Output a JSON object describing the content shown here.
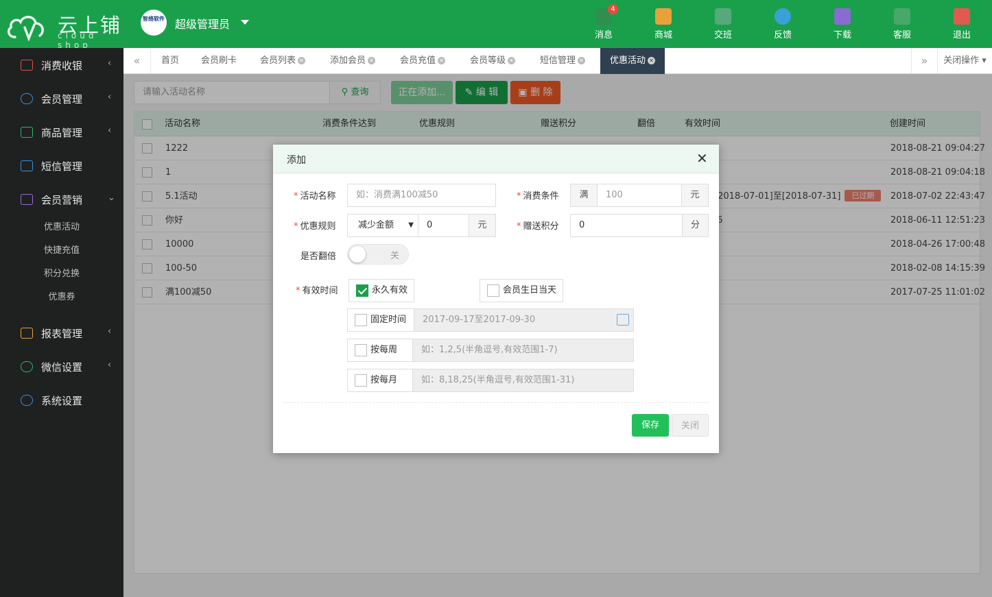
{
  "brand": {
    "name": "云上铺",
    "sub": "cloud shop"
  },
  "user": {
    "avatar_text": "智络软件",
    "name": "超级管理员"
  },
  "topnav": [
    {
      "label": "消息",
      "icon": "paper-plane-icon",
      "color": "#2f8f4e",
      "badge": "4"
    },
    {
      "label": "商城",
      "icon": "store-icon",
      "color": "#e8a13a"
    },
    {
      "label": "交班",
      "icon": "swap-icon",
      "color": "#57a97c"
    },
    {
      "label": "反馈",
      "icon": "chat-icon",
      "color": "#3aa0d8"
    },
    {
      "label": "下载",
      "icon": "download-icon",
      "color": "#8a6bd1"
    },
    {
      "label": "客服",
      "icon": "support-icon",
      "color": "#47a86b"
    },
    {
      "label": "退出",
      "icon": "power-icon",
      "color": "#e05a4f"
    }
  ],
  "sidebar": {
    "items": [
      {
        "label": "消费收银",
        "icon": "cashier-icon",
        "chevron": "‹"
      },
      {
        "label": "会员管理",
        "icon": "members-icon",
        "chevron": "‹"
      },
      {
        "label": "商品管理",
        "icon": "goods-icon",
        "chevron": "‹"
      },
      {
        "label": "短信管理",
        "icon": "sms-icon",
        "chevron": ""
      },
      {
        "label": "会员营销",
        "icon": "gift-icon",
        "chevron": "⌄"
      },
      {
        "label": "报表管理",
        "icon": "chart-icon",
        "chevron": "‹"
      },
      {
        "label": "微信设置",
        "icon": "wechat-icon",
        "chevron": "‹"
      },
      {
        "label": "系统设置",
        "icon": "settings-icon",
        "chevron": ""
      }
    ],
    "subitems": [
      "优惠活动",
      "快捷充值",
      "积分兑换",
      "优惠券"
    ]
  },
  "tabs": {
    "items": [
      "首页",
      "会员刷卡",
      "会员列表",
      "添加会员",
      "会员充值",
      "会员等级",
      "短信管理",
      "优惠活动"
    ],
    "close_ops": "关闭操作"
  },
  "toolbar": {
    "search_placeholder": "请输入活动名称",
    "query": "查询",
    "adding": "正在添加...",
    "edit": "编 辑",
    "delete": "删 除"
  },
  "table": {
    "headers": [
      "活动名称",
      "消费条件达到",
      "优惠规则",
      "赠送积分",
      "翻倍",
      "有效时间",
      "创建时间"
    ],
    "rows": [
      {
        "name": "1222",
        "valid": "",
        "created": "2018-08-21 09:04:27"
      },
      {
        "name": "1",
        "valid": "",
        "created": "2018-08-21 09:04:18"
      },
      {
        "name": "5.1活动",
        "valid": "[2018-07-01]至[2018-07-31]",
        "badge": "已过期",
        "created": "2018-07-02 22:43:47"
      },
      {
        "name": "你好",
        "valid": ",6",
        "created": "2018-06-11 12:51:23"
      },
      {
        "name": "10000",
        "valid": "",
        "created": "2018-04-26 17:00:48"
      },
      {
        "name": "100-50",
        "valid": "",
        "created": "2018-02-08 14:15:39"
      },
      {
        "name": "满100减50",
        "valid": "",
        "created": "2017-07-25 11:01:02"
      }
    ]
  },
  "modal": {
    "title": "添加",
    "name_label": "活动名称",
    "name_placeholder": "如：消费满100减50",
    "cond_label": "消费条件",
    "cond_prefix": "满",
    "cond_placeholder": "100",
    "cond_unit": "元",
    "rule_label": "优惠规则",
    "rule_select": "减少金额",
    "rule_value": "0",
    "rule_unit": "元",
    "points_label": "赠送积分",
    "points_value": "0",
    "points_unit": "分",
    "double_label": "是否翻倍",
    "double_state": "关",
    "valid_label": "有效时间",
    "forever": "永久有效",
    "birthday": "会员生日当天",
    "fixed": "固定时间",
    "fixed_range": "2017-09-17至2017-09-30",
    "weekly": "按每周",
    "weekly_placeholder": "如：1,2,5(半角逗号,有效范围1-7)",
    "monthly": "按每月",
    "monthly_placeholder": "如：8,18,25(半角逗号,有效范围1-31)",
    "save": "保存",
    "close": "关闭"
  }
}
